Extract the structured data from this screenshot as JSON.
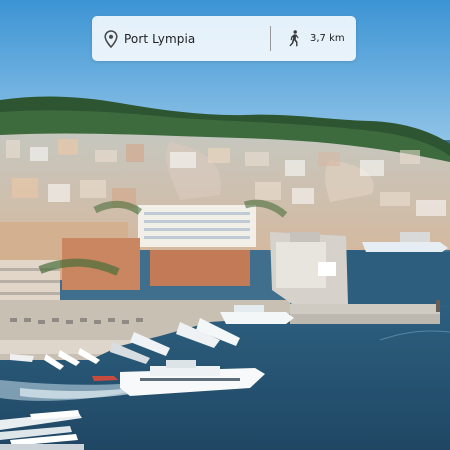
{
  "location_card": {
    "place_icon": "map-pin-icon",
    "place_name": "Port Lympia",
    "distance_icon": "walking-person-icon",
    "distance": "3,7 km"
  },
  "photo": {
    "subject": "aerial-harbor-photo"
  }
}
